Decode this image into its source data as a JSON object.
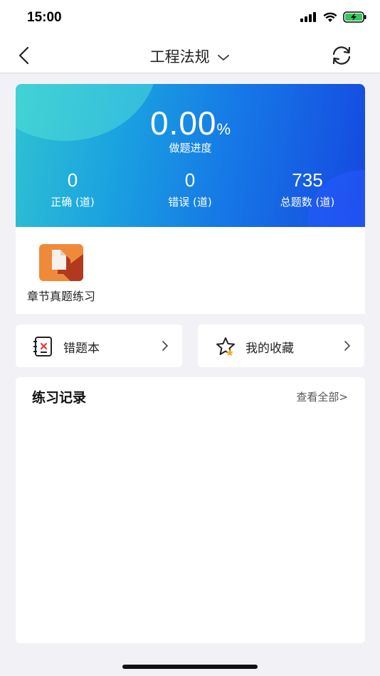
{
  "status_bar": {
    "time": "15:00"
  },
  "nav": {
    "title": "工程法规"
  },
  "progress": {
    "value": "0.00",
    "unit": "%",
    "label": "做题进度"
  },
  "stats": [
    {
      "value": "0",
      "label": "正确 (道)"
    },
    {
      "value": "0",
      "label": "错误 (道)"
    },
    {
      "value": "735",
      "label": "总题数 (道)"
    }
  ],
  "chapter": {
    "label": "章节真题练习"
  },
  "actions": {
    "wrong_book": "错题本",
    "favorites": "我的收藏"
  },
  "record": {
    "title": "练习记录",
    "view_all": "查看全部>"
  },
  "colors": {
    "accent_start": "#2fc2d2",
    "accent_end": "#1548e0",
    "chapter_icon": "#ef8a3a"
  }
}
